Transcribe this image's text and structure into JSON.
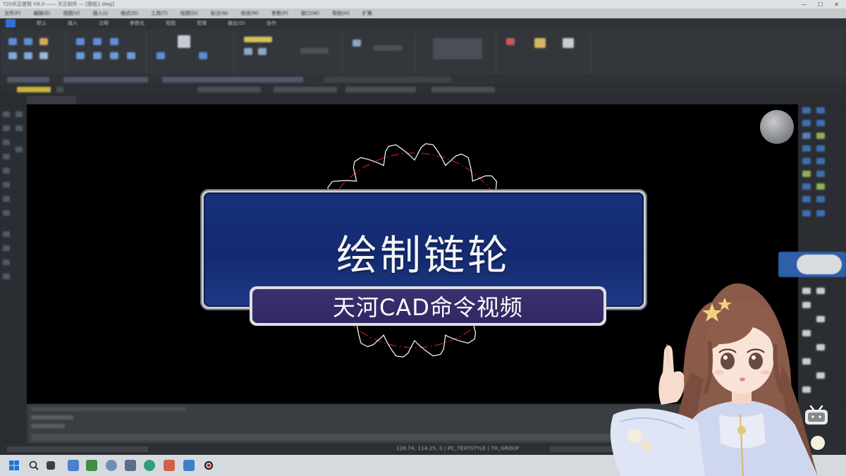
{
  "window": {
    "title": "T20天正建筑 V8.0 —— 天正软件 — [图纸1.dwg]",
    "controls": [
      "—",
      "☐",
      "✕"
    ]
  },
  "menubar": {
    "items": [
      "文件(F)",
      "编辑(E)",
      "视图(V)",
      "插入(I)",
      "格式(O)",
      "工具(T)",
      "绘图(D)",
      "标注(N)",
      "修改(M)",
      "参数(P)",
      "窗口(W)",
      "帮助(H)",
      "扩展"
    ]
  },
  "ribbon": {
    "tabs": [
      "默认",
      "插入",
      "注释",
      "参数化",
      "视图",
      "管理",
      "输出(O)",
      "协作"
    ]
  },
  "drawing": {
    "file_tab": "图纸1",
    "title": "绘制链轮",
    "subtitle": "天河CAD命令视频"
  },
  "statusbar": {
    "coordinates": "128.74, 114.25, 0",
    "textstyle": "PC_TEXTSTYLE",
    "layer": "TH_GROUP"
  },
  "colors": {
    "banner_blue": "#142a70",
    "subbanner_purple": "#302862",
    "gear_outline": "#ffffff",
    "pitch_circle": "#d01818",
    "accent": "#2e6fd8"
  },
  "icons": {
    "start": "windows-start-icon",
    "search": "search-icon",
    "watermark": "bilibili-tv-icon"
  }
}
